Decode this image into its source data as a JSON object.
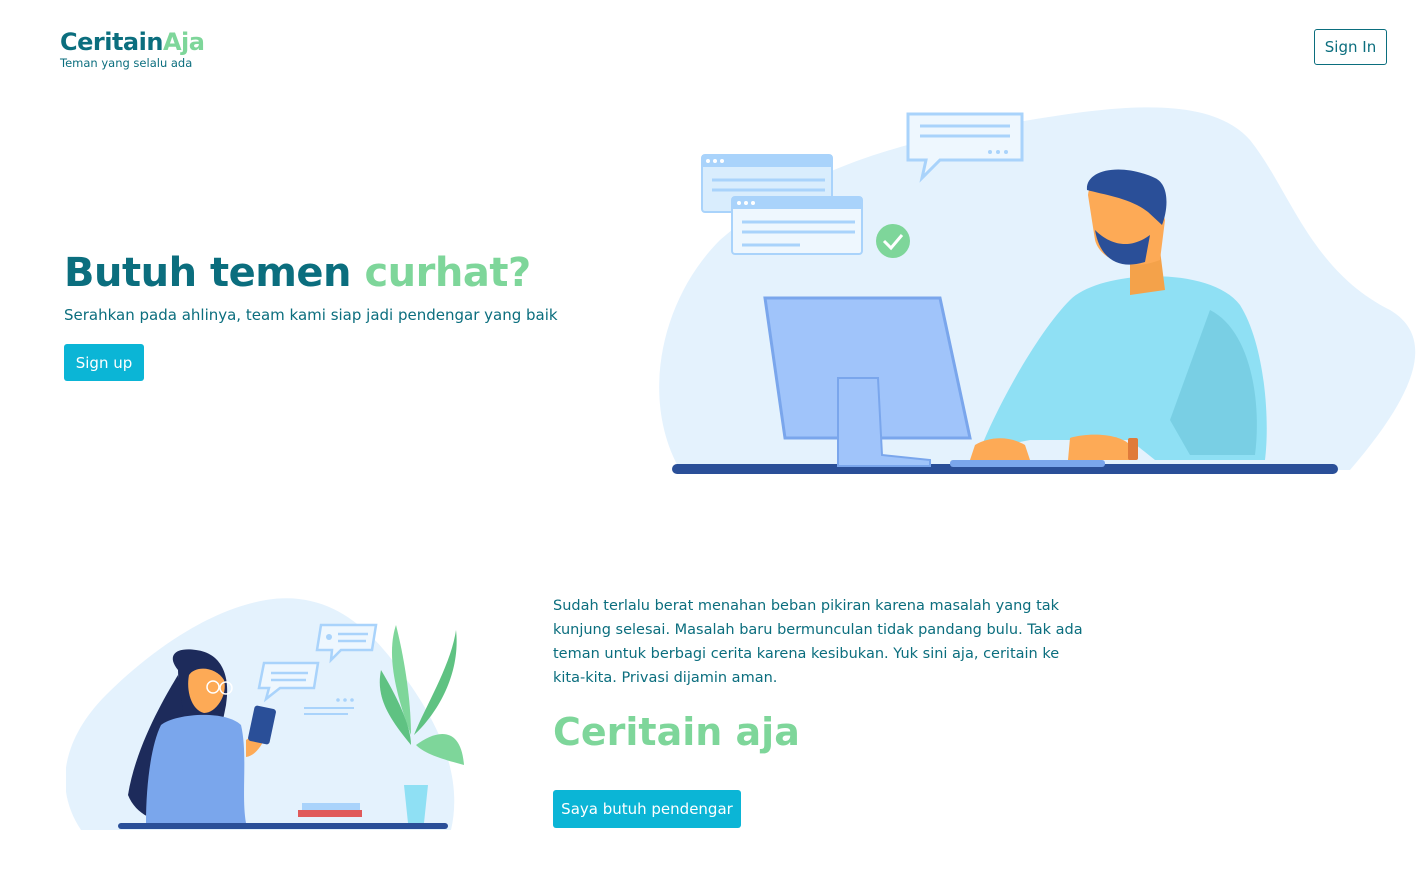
{
  "brand": {
    "name_part1": "Ceritain",
    "name_part2": "Aja",
    "tagline": "Teman yang selalu ada"
  },
  "header": {
    "signin_label": "Sign In"
  },
  "hero": {
    "title_part1": "Butuh temen",
    "title_part2": "curhat?",
    "subtitle": "Serahkan pada ahlinya, team kami siap jadi pendengar yang baik",
    "signup_label": "Sign up"
  },
  "section": {
    "paragraph": "Sudah terlalu berat menahan beban pikiran karena masalah yang tak kunjung selesai. Masalah baru bermunculan tidak pandang bulu. Tak ada teman untuk berbagi cerita karena kesibukan. Yuk sini aja, ceritain ke kita-kita. Privasi dijamin aman.",
    "title": "Ceritain aja",
    "cta_label": "Saya butuh pendengar"
  },
  "colors": {
    "primary": "#0b6e7e",
    "accent": "#7ed69a",
    "button": "#0bb5d6"
  }
}
